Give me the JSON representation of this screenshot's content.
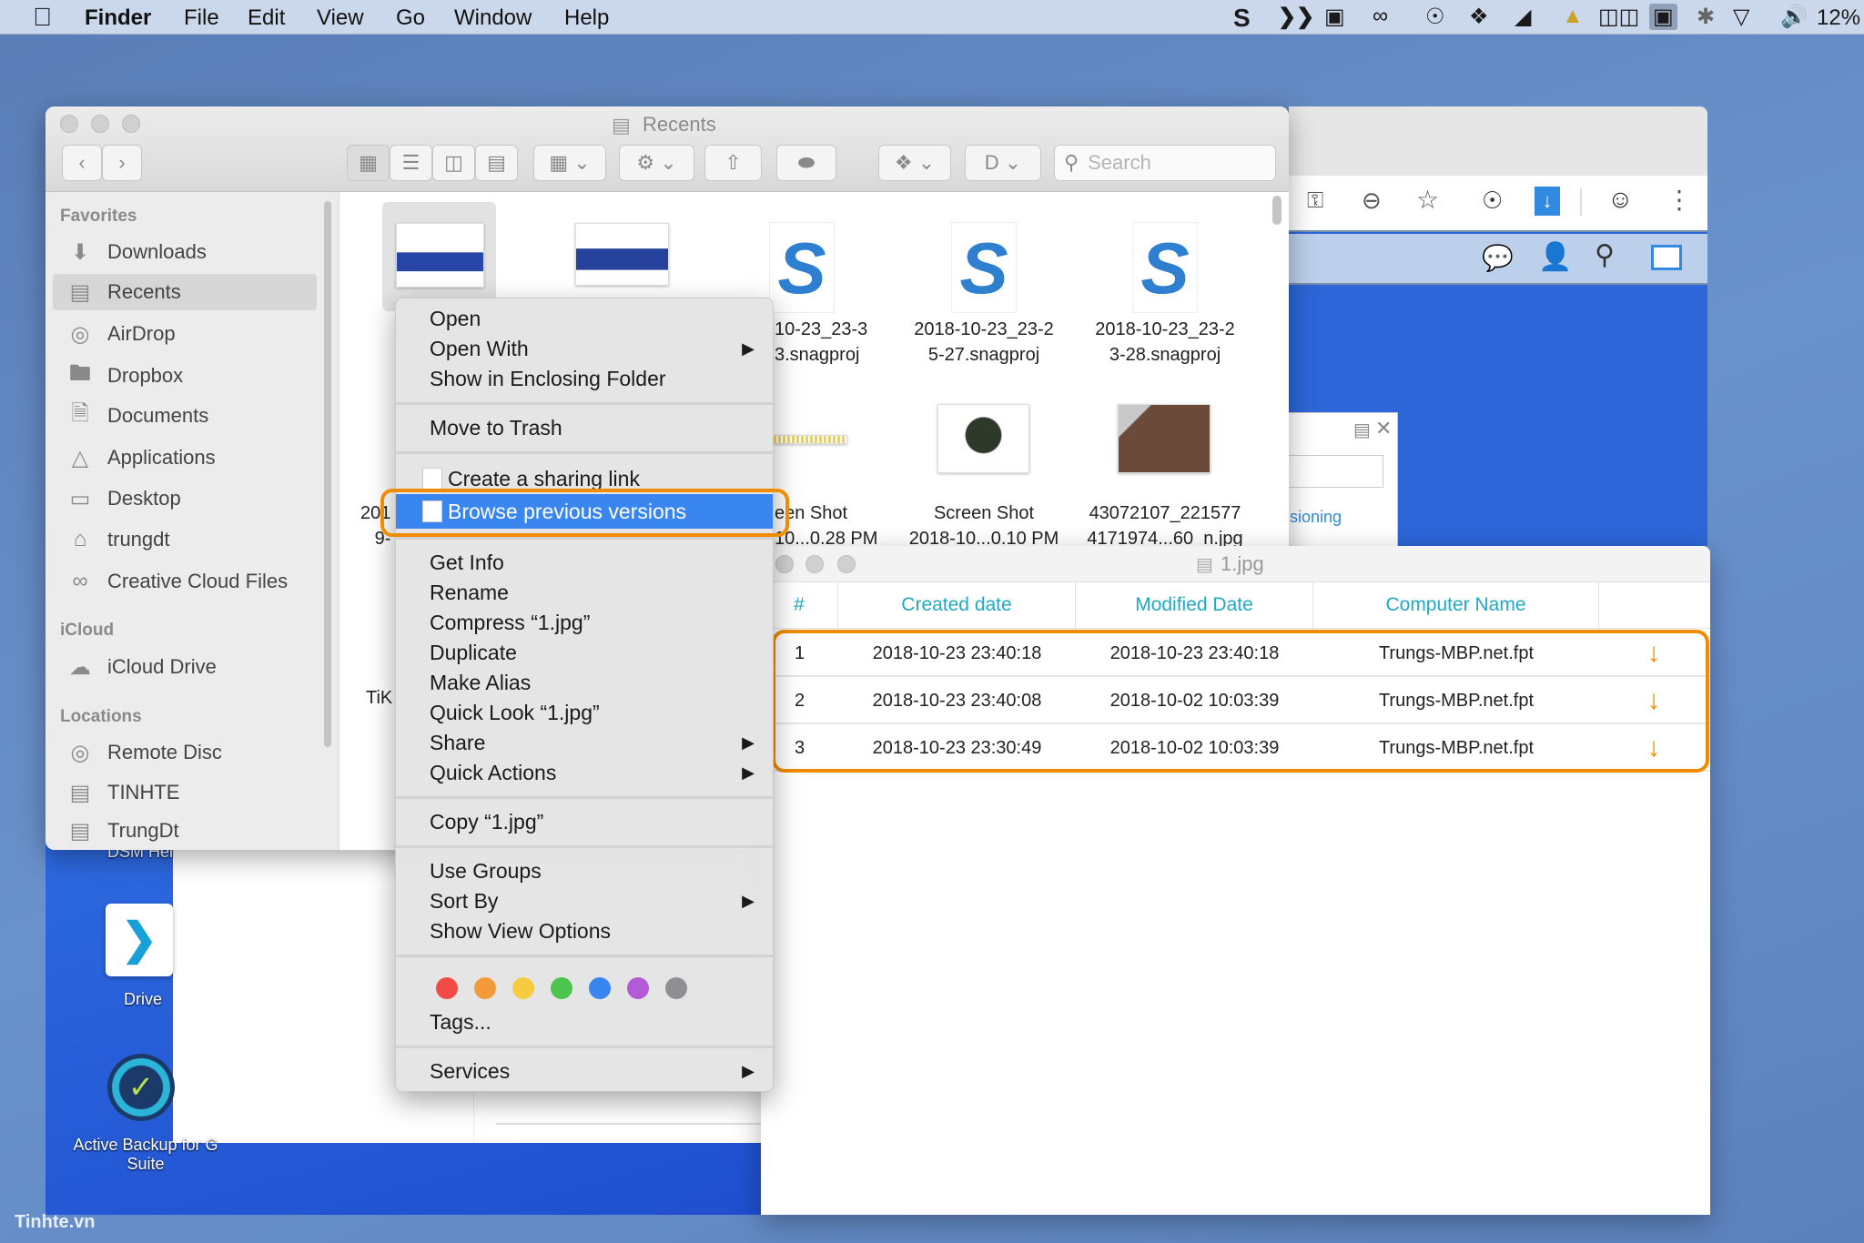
{
  "menubar": {
    "apple_icon": "apple-logo-icon",
    "app_name": "Finder",
    "menus": [
      "File",
      "Edit",
      "View",
      "Go",
      "Window",
      "Help"
    ],
    "status_icons": [
      "snagit-icon",
      "drive-icon",
      "display-icon",
      "creative-cloud-icon",
      "1password-icon",
      "dropbox-icon",
      "notification-icon",
      "vlc-cone-icon",
      "screens-icon",
      "screen-sharing-icon",
      "bluetooth-icon",
      "wifi-icon",
      "volume-icon"
    ],
    "battery": "12%"
  },
  "finder": {
    "title": "Recents",
    "search_placeholder": "Search",
    "sidebar": {
      "favorites_header": "Favorites",
      "favorites": [
        {
          "label": "Downloads",
          "icon": "downloads-icon"
        },
        {
          "label": "Recents",
          "icon": "recents-icon",
          "selected": true
        },
        {
          "label": "AirDrop",
          "icon": "airdrop-icon"
        },
        {
          "label": "Dropbox",
          "icon": "folder-icon"
        },
        {
          "label": "Documents",
          "icon": "documents-icon"
        },
        {
          "label": "Applications",
          "icon": "applications-icon"
        },
        {
          "label": "Desktop",
          "icon": "desktop-icon"
        },
        {
          "label": "trungdt",
          "icon": "home-icon"
        },
        {
          "label": "Creative Cloud Files",
          "icon": "creative-cloud-icon"
        }
      ],
      "icloud_header": "iCloud",
      "icloud": [
        {
          "label": "iCloud Drive",
          "icon": "cloud-icon"
        }
      ],
      "locations_header": "Locations",
      "locations": [
        {
          "label": "Remote Disc",
          "icon": "disc-icon"
        },
        {
          "label": "TINHTE",
          "icon": "server-icon"
        },
        {
          "label": "TrungDt",
          "icon": "server-icon"
        }
      ]
    },
    "files": [
      {
        "lines": [
          "201",
          "9-"
        ]
      },
      {
        "lines": [
          "10-23_23-3",
          "3.snagproj"
        ]
      },
      {
        "lines": [
          "2018-10-23_23-2",
          "5-27.snagproj"
        ]
      },
      {
        "lines": [
          "2018-10-23_23-2",
          "3-28.snagproj"
        ]
      },
      {
        "lines": [
          "een Shot",
          "10...0.28 PM"
        ]
      },
      {
        "lines": [
          "Screen Shot",
          "2018-10...0.10 PM"
        ]
      },
      {
        "lines": [
          "43072107_221577",
          "4171974...60_n.jpg"
        ]
      },
      {
        "lines": [
          "TiK"
        ]
      }
    ]
  },
  "context_menu": {
    "open": "Open",
    "open_with": "Open With",
    "show_enclosing": "Show in Enclosing Folder",
    "move_to_trash": "Move to Trash",
    "create_sharing_link": "Create a sharing link",
    "browse_previous_versions": "Browse previous versions",
    "get_info": "Get Info",
    "rename": "Rename",
    "compress": "Compress “1.jpg”",
    "duplicate": "Duplicate",
    "make_alias": "Make Alias",
    "quick_look": "Quick Look “1.jpg”",
    "share": "Share",
    "quick_actions": "Quick Actions",
    "copy": "Copy “1.jpg”",
    "use_groups": "Use Groups",
    "sort_by": "Sort By",
    "show_view_options": "Show View Options",
    "tag_colors": [
      "#f24a47",
      "#f59a3a",
      "#f7cb3f",
      "#4cc54f",
      "#3a86f0",
      "#b35bd6",
      "#8e8e93"
    ],
    "tags": "Tags...",
    "services": "Services",
    "highlight_color": "#f08c00"
  },
  "browser": {
    "tab_partial": "sioning"
  },
  "versions": {
    "title": "1.jpg",
    "headers": [
      "#",
      "Created date",
      "Modified Date",
      "Computer Name"
    ],
    "rows": [
      {
        "n": "1",
        "created": "2018-10-23 23:40:18",
        "modified": "2018-10-23 23:40:18",
        "computer": "Trungs-MBP.net.fpt"
      },
      {
        "n": "2",
        "created": "2018-10-23 23:40:08",
        "modified": "2018-10-02 10:03:39",
        "computer": "Trungs-MBP.net.fpt"
      },
      {
        "n": "3",
        "created": "2018-10-23 23:30:49",
        "modified": "2018-10-02 10:03:39",
        "computer": "Trungs-MBP.net.fpt"
      }
    ],
    "accent": "#1fa9c4",
    "download_color": "#f08c00"
  },
  "desktop": {
    "dsm_label": "DSM Hel",
    "drive_label": "Drive",
    "backup_label_1": "Active Backup for G",
    "backup_label_2": "Suite",
    "watermark": "Tinhte.vn"
  }
}
